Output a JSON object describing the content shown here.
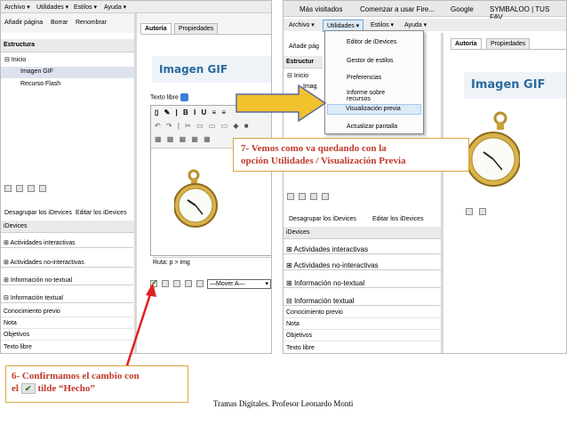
{
  "left": {
    "menu": [
      "Archivo ▾",
      "Utilidades ▾",
      "Estilos ▾",
      "Ayuda ▾"
    ],
    "toolbar": [
      "Añadir página",
      "Borrar",
      "Renombrar"
    ],
    "estructura_title": "Estructura",
    "tree": [
      "Inicio",
      "Imagen GIF",
      "Recurso Flash"
    ],
    "group_buttons": [
      "Desagrupar los iDevices",
      "Editar los iDevices"
    ],
    "idevices_title": "iDevices",
    "categories": [
      "Actividades interactivas",
      "Actividades no-interactivas",
      "Información no-textual",
      "Información textual"
    ],
    "subitems": [
      "Conocimiento previo",
      "Nota",
      "Objetivos",
      "Texto libre"
    ],
    "tabs": [
      "Autoría",
      "Propiedades"
    ],
    "page_title": "Imagen GIF",
    "texto_libre": "Texto libre",
    "ruta": "Ruta: p > img",
    "mover": "—Mover A—"
  },
  "right": {
    "bookmarks": [
      "Más visitados",
      "Comenzar a usar Fire...",
      "Google",
      "SYMBALOO | TUS FAV..."
    ],
    "menu": [
      "Archivo ▾",
      "Utilidades ▾",
      "Estilos ▾",
      "Ayuda ▾"
    ],
    "toolbar": [
      "Añadir pág",
      "Estructur",
      "Inicio",
      "Imag"
    ],
    "dropdown": [
      "Editor de iDevices",
      "Gestor de estilos",
      "Preferencias",
      "Informe sobre recursos",
      "Visualización previa",
      "Actualizar pantalla"
    ],
    "tabs": [
      "Autoría",
      "Propiedades"
    ],
    "page_title": "Imagen GIF",
    "group_buttons": [
      "Desagrupar los iDevices",
      "Editar los iDevices"
    ],
    "idevices_title": "iDevices",
    "categories": [
      "Actividades interactivas",
      "Actividades no-interactivas",
      "Información no-textual",
      "Información textual"
    ],
    "subitems": [
      "Conocimiento previo",
      "Nota",
      "Objetivos",
      "Texto libre"
    ]
  },
  "callout7": {
    "line1": "7- Vemos como va quedando con la",
    "line2": "opción Utilidades / Visualización Previa"
  },
  "callout6": {
    "line1": "6- Confirmamos el cambio con",
    "line2a": "el",
    "line2b": "tilde  “Hecho”"
  },
  "footer": "Tramas Digitales. Profesor Leonardo Monti",
  "colors": {
    "accent_red": "#e02020",
    "callout_text": "#c0392b",
    "arrow_fill": "#f2c12e",
    "title_blue": "#2c6a9e"
  }
}
